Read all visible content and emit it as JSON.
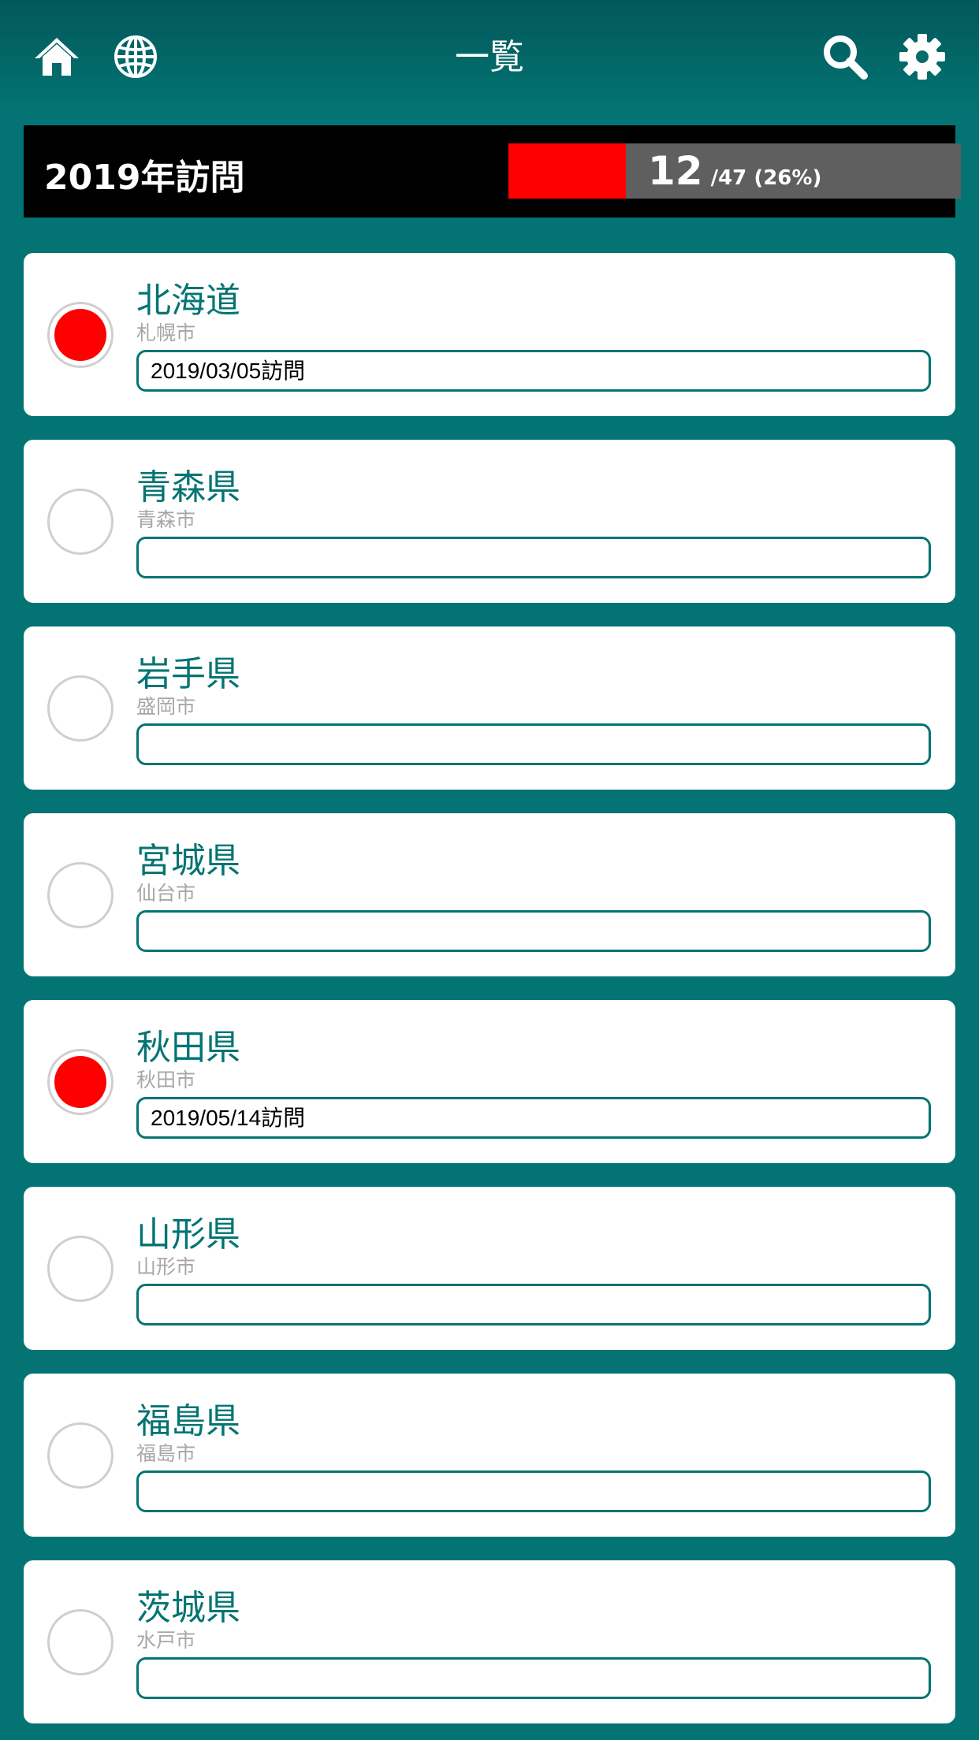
{
  "header": {
    "title": "一覧",
    "icons": [
      "home-icon",
      "globe-icon",
      "search-icon",
      "gear-icon"
    ]
  },
  "stats": {
    "label": "2019年訪問",
    "visited": "12",
    "total_text": "/47 (26%)",
    "progress_fraction": 0.26,
    "fill_color": "#ff0000",
    "track_color": "#5f5f5f"
  },
  "colors": {
    "accent": "#037473",
    "visited_dot": "#ff0000"
  },
  "prefectures": [
    {
      "name": "北海道",
      "capital": "札幌市",
      "note": "2019/03/05訪問",
      "visited": true
    },
    {
      "name": "青森県",
      "capital": "青森市",
      "note": "",
      "visited": false
    },
    {
      "name": "岩手県",
      "capital": "盛岡市",
      "note": "",
      "visited": false
    },
    {
      "name": "宮城県",
      "capital": "仙台市",
      "note": "",
      "visited": false
    },
    {
      "name": "秋田県",
      "capital": "秋田市",
      "note": "2019/05/14訪問",
      "visited": true
    },
    {
      "name": "山形県",
      "capital": "山形市",
      "note": "",
      "visited": false
    },
    {
      "name": "福島県",
      "capital": "福島市",
      "note": "",
      "visited": false
    },
    {
      "name": "茨城県",
      "capital": "水戸市",
      "note": "",
      "visited": false
    }
  ]
}
